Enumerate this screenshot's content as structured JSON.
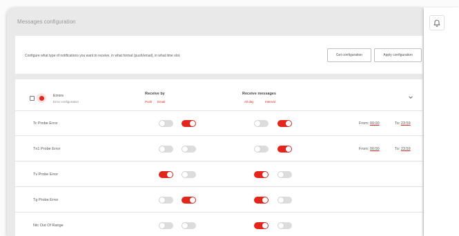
{
  "window": {
    "title": "Messages configuration"
  },
  "info": {
    "text": "Configure what type of notifications you want to receive, in what format (push/email), in what time slot.",
    "get_label": "Get configuration",
    "apply_label": "Apply configuration"
  },
  "group": {
    "title": "Errors",
    "subtitle": "Error configuration",
    "receive_by": {
      "title": "Receive by",
      "options": [
        "Push",
        "Email"
      ]
    },
    "receive_messages": {
      "title": "Receive messages",
      "options": [
        "All day",
        "Interval"
      ]
    }
  },
  "rows": [
    {
      "label": "Tc Probe Error",
      "push": false,
      "email": true,
      "all_day": false,
      "interval": true,
      "from_label": "From:",
      "from": "00:00",
      "to_label": "To:",
      "to": "23:59"
    },
    {
      "label": "Tn1 Probe Error",
      "push": false,
      "email": false,
      "all_day": false,
      "interval": true,
      "from_label": "From:",
      "from": "00:00",
      "to_label": "To:",
      "to": "23:59"
    },
    {
      "label": "Tv Probe Error",
      "push": true,
      "email": false,
      "all_day": true,
      "interval": false
    },
    {
      "label": "Tg Probe Error",
      "push": false,
      "email": true,
      "all_day": true,
      "interval": false
    },
    {
      "label": "Ntc Out Of Range",
      "push": false,
      "email": false,
      "all_day": true,
      "interval": false
    }
  ],
  "colors": {
    "accent": "#e2261c",
    "toggle_off": "#dcdcdc",
    "window_bg": "#e9e9ea"
  },
  "icons": {
    "group": "error-icon",
    "collapse": "chevron-down-icon",
    "notifications": "bell-icon"
  }
}
